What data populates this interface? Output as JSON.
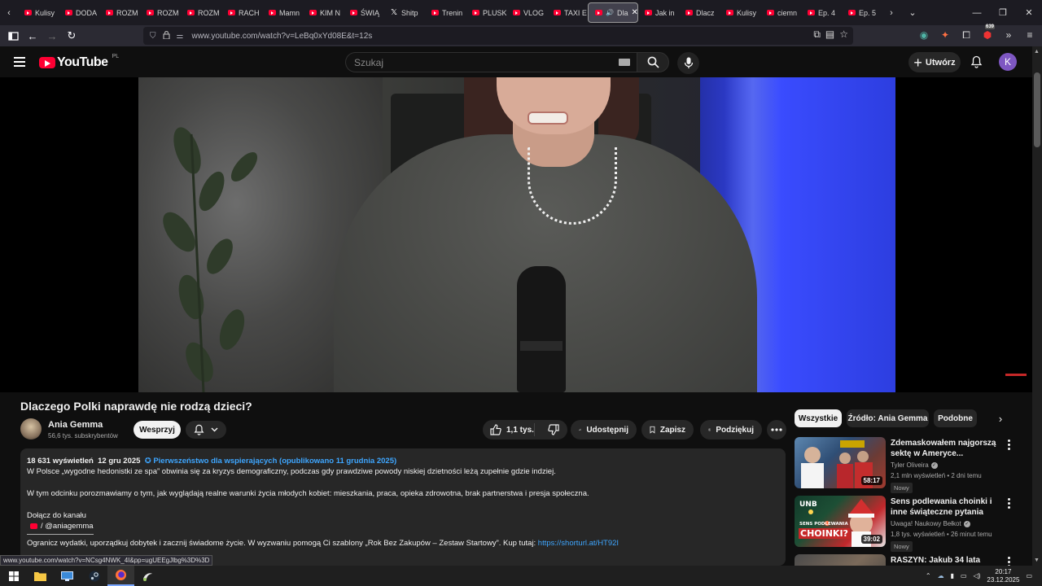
{
  "browser": {
    "tabs": [
      {
        "label": "Kulisy",
        "icon": "youtube-icon"
      },
      {
        "label": "DODA",
        "icon": "youtube-icon"
      },
      {
        "label": "ROZM",
        "icon": "youtube-icon"
      },
      {
        "label": "ROZM",
        "icon": "youtube-icon"
      },
      {
        "label": "ROZM",
        "icon": "youtube-icon"
      },
      {
        "label": "RACH",
        "icon": "youtube-icon"
      },
      {
        "label": "Mamn",
        "icon": "youtube-icon"
      },
      {
        "label": "KIM N",
        "icon": "youtube-icon"
      },
      {
        "label": "ŚWIĄ",
        "icon": "youtube-icon"
      },
      {
        "label": "Shitp",
        "icon": "x-icon"
      },
      {
        "label": "Trenin",
        "icon": "youtube-icon"
      },
      {
        "label": "PLUSK",
        "icon": "youtube-icon"
      },
      {
        "label": "VLOG",
        "icon": "youtube-icon"
      },
      {
        "label": "TAXI E",
        "icon": "youtube-icon"
      },
      {
        "label": "Dla",
        "icon": "youtube-icon",
        "active": true
      },
      {
        "label": "Jak in",
        "icon": "youtube-icon"
      },
      {
        "label": "Dlacz",
        "icon": "youtube-icon"
      },
      {
        "label": "Kulisy",
        "icon": "youtube-icon"
      },
      {
        "label": "ciemn",
        "icon": "youtube-icon"
      },
      {
        "label": "Ep. 4",
        "icon": "youtube-icon"
      },
      {
        "label": "Ep. 5",
        "icon": "youtube-icon"
      }
    ],
    "url": "www.youtube.com/watch?v=LeBq0xYd08E&t=12s",
    "extension_badge": "639",
    "status_url": "www.youtube.com/watch?v=NCsg4NWK_4I&pp=ugUEEgJlbg%3D%3D"
  },
  "youtube": {
    "logo_text": "YouTube",
    "country_code": "PL",
    "search_placeholder": "Szukaj",
    "create_label": "Utwórz",
    "avatar_letter": "K"
  },
  "video": {
    "title": "Dlaczego Polki naprawdę nie rodzą dzieci?",
    "channel": "Ania Gemma",
    "subscribers": "56,6 tys. subskrybentów",
    "support_label": "Wesprzyj",
    "likes": "1,1 tys.",
    "share_label": "Udostępnij",
    "save_label": "Zapisz",
    "thanks_label": "Podziękuj"
  },
  "description": {
    "views": "18 631 wyświetleń",
    "date": "12 gru 2025",
    "early_access": "Pierwszeństwo dla wspierających (opublikowano 11 grudnia 2025)",
    "line1": "W Polsce „wygodne hedonistki ze spa” obwinia się za kryzys demograficzny, podczas gdy prawdziwe powody niskiej dzietności leżą zupełnie gdzie indziej.",
    "line2": "W tym odcinku porozmawiamy o tym, jak wyglądają realne warunki życia młodych kobiet: mieszkania, praca, opieka zdrowotna, brak partnerstwa i presja społeczna.",
    "join": "Dołącz do kanału",
    "handle": "/ @aniagemma",
    "promo": "Ogranicz wydatki, uporządkuj dobytek i zacznij świadome życie. W wyzwaniu pomogą Ci szablony „Rok Bez Zakupów – Zestaw Startowy”. Kup tutaj:",
    "promo_link": "https://shorturl.at/HT92I"
  },
  "chips": [
    "Wszystkie",
    "Źródło: Ania Gemma",
    "Podobne"
  ],
  "recommendations": [
    {
      "title": "Zdemaskowałem najgorszą sektę w Ameryce...",
      "channel": "Tyler Oliveira",
      "verified": true,
      "meta": "2,1 mln wyświetleń • 2 dni temu",
      "badge": "Nowy",
      "duration": "58:17"
    },
    {
      "title": "Sens podlewania choinki i inne świąteczne pytania",
      "channel": "Uwaga! Naukowy Bełkot",
      "verified": true,
      "meta": "1,8 tys. wyświetleń • 26 minut temu",
      "badge": "Nowy",
      "duration": "39:02",
      "thumb_text": "SENS PODLEWANIA",
      "thumb_text2": "CHOINKI?",
      "thumb_logo": "UNB"
    },
    {
      "title": "RASZYN: Jakub 34 lata"
    }
  ],
  "taskbar": {
    "time": "20:17",
    "date": "23.12.2025"
  },
  "colors": {
    "youtube_red": "#ff0033",
    "link_blue": "#3ea6ff",
    "background": "#0f0f0f",
    "surface": "#272727"
  }
}
